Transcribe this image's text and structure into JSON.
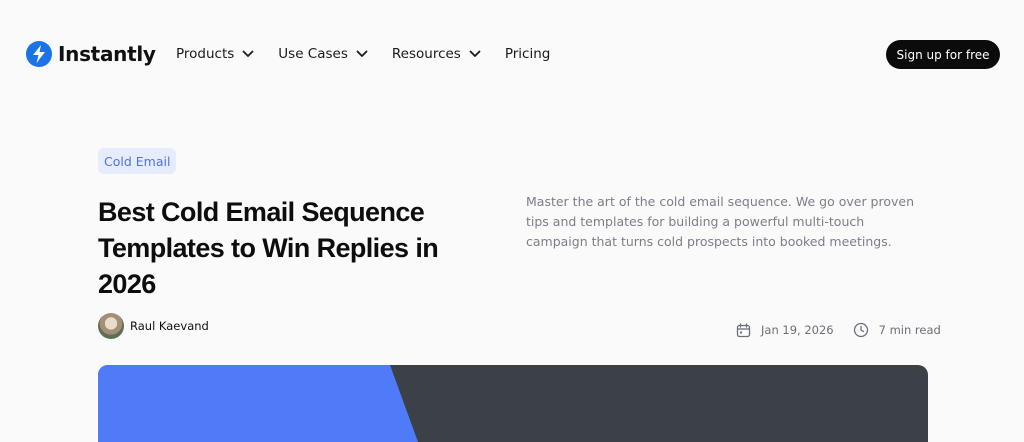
{
  "brand": {
    "name": "Instantly",
    "icon": "lightning-bolt-icon",
    "color": "#1a73e8"
  },
  "nav": {
    "items": [
      {
        "label": "Products",
        "has_dropdown": true
      },
      {
        "label": "Use Cases",
        "has_dropdown": true
      },
      {
        "label": "Resources",
        "has_dropdown": true
      },
      {
        "label": "Pricing",
        "has_dropdown": false
      }
    ],
    "cta_label": "Sign up for free"
  },
  "article": {
    "category": "Cold Email",
    "title": "Best Cold Email Sequence Templates to Win Replies in 2026",
    "description": "Master the art of the cold email sequence. We go over proven tips and templates for building a powerful multi-touch campaign that turns cold prospects into booked meetings.",
    "author": "Raul Kaevand",
    "date": "Jan 19, 2026",
    "read_time": "7 min read"
  },
  "colors": {
    "accent_blue": "#4f7bf9",
    "tag_bg": "#e6ecfb",
    "tag_text": "#4b74e4",
    "hero_dark": "#3c4047",
    "cta_bg": "#0b0b0b"
  }
}
